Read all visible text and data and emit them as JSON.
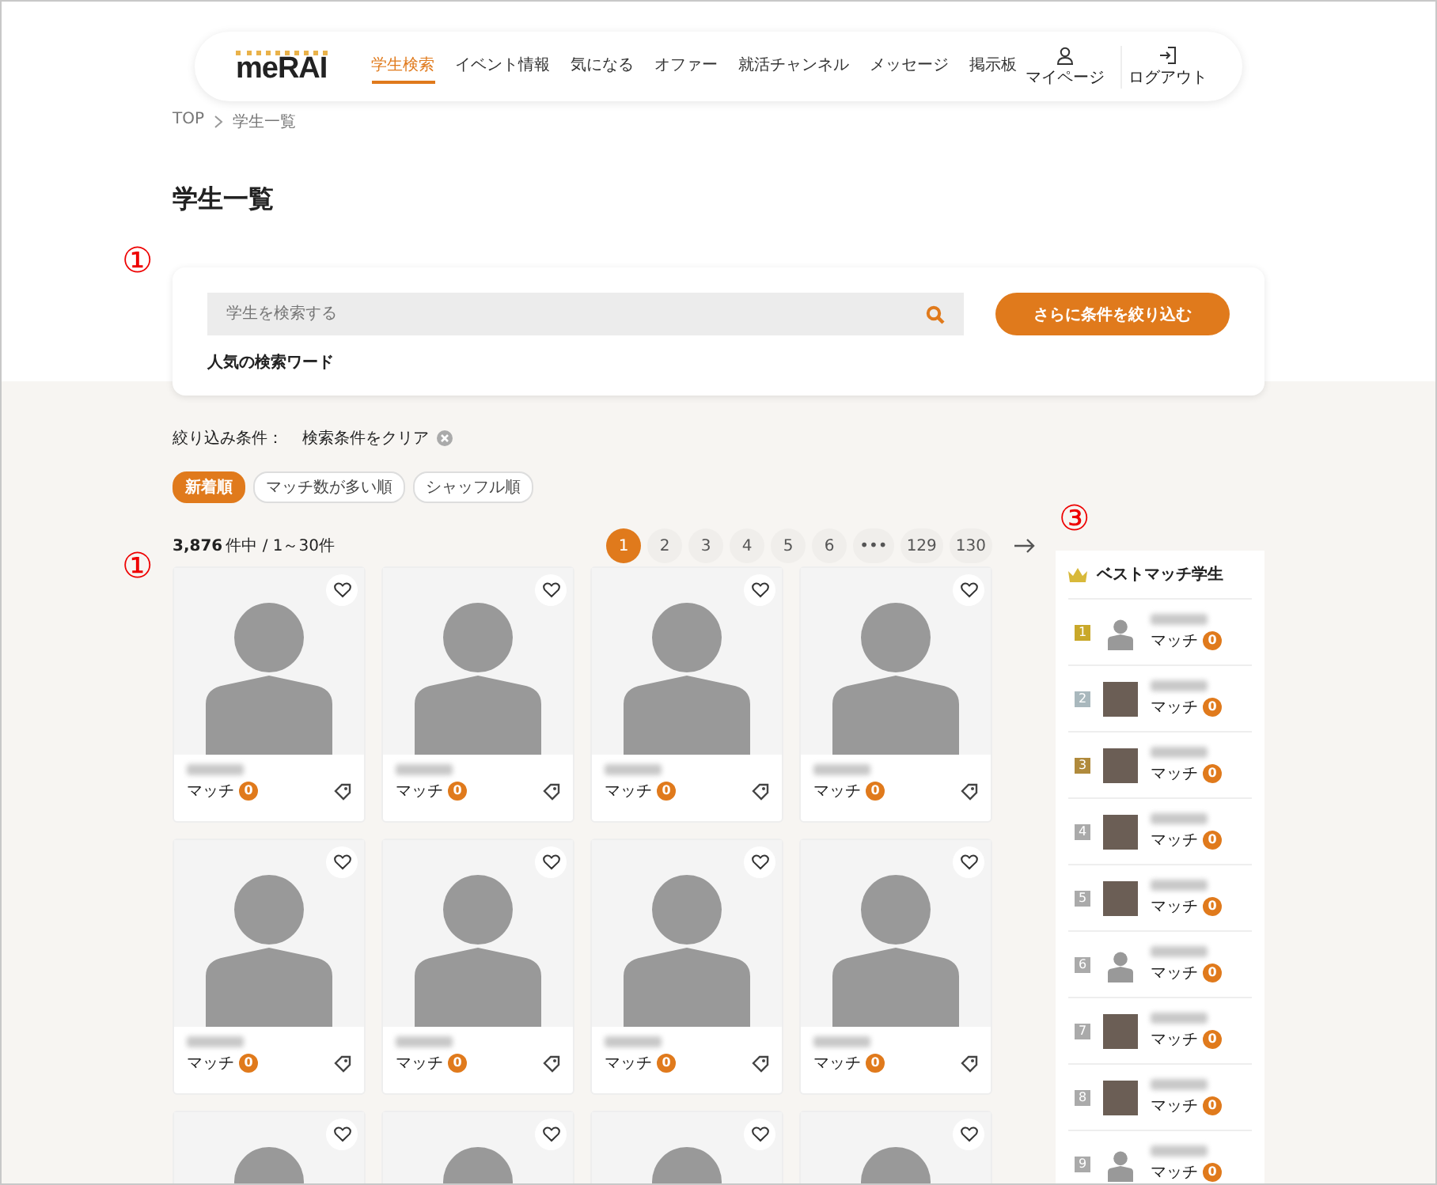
{
  "header": {
    "logo": "meRAI",
    "nav": [
      {
        "label": "学生検索",
        "selected": true
      },
      {
        "label": "イベント情報",
        "selected": false
      },
      {
        "label": "気になる",
        "selected": false
      },
      {
        "label": "オファー",
        "selected": false
      },
      {
        "label": "就活チャンネル",
        "selected": false
      },
      {
        "label": "メッセージ",
        "selected": false
      },
      {
        "label": "掲示板",
        "selected": false
      }
    ],
    "actions": [
      {
        "kind": "user",
        "label": "マイページ"
      },
      {
        "kind": "logout",
        "label": "ログアウト"
      }
    ]
  },
  "breadcrumb": [
    "TOP",
    "学生一覧"
  ],
  "page_title": "学生一覧",
  "search": {
    "annotation": "①",
    "placeholder": "学生を検索する",
    "button": "さらに条件を絞り込む",
    "popular_label": "人気の検索ワード"
  },
  "filter": {
    "label": "絞り込み条件：",
    "clear": "検索条件をクリア"
  },
  "sort": [
    {
      "label": "新着順",
      "selected": true
    },
    {
      "label": "マッチ数が多い順",
      "selected": false
    },
    {
      "label": "シャッフル順",
      "selected": false
    }
  ],
  "results": {
    "total": "3,876",
    "range": "件中 / 1～30件",
    "annotation": "①"
  },
  "pagination": [
    {
      "label": "1",
      "selected": true
    },
    {
      "label": "2",
      "selected": false
    },
    {
      "label": "3",
      "selected": false
    },
    {
      "label": "4",
      "selected": false
    },
    {
      "label": "5",
      "selected": false
    },
    {
      "label": "6",
      "selected": false
    },
    {
      "label": "•••",
      "selected": false
    },
    {
      "label": "129",
      "selected": false
    },
    {
      "label": "130",
      "selected": false
    }
  ],
  "cards": [
    {
      "favorite": false,
      "match_label": "マッチ",
      "match_count": "0"
    },
    {
      "favorite": false,
      "match_label": "マッチ",
      "match_count": "0"
    },
    {
      "favorite": false,
      "match_label": "マッチ",
      "match_count": "0"
    },
    {
      "favorite": false,
      "match_label": "マッチ",
      "match_count": "0"
    },
    {
      "favorite": false,
      "match_label": "マッチ",
      "match_count": "0"
    },
    {
      "favorite": false,
      "match_label": "マッチ",
      "match_count": "0"
    },
    {
      "favorite": false,
      "match_label": "マッチ",
      "match_count": "0"
    },
    {
      "favorite": false,
      "match_label": "マッチ",
      "match_count": "0"
    },
    {
      "favorite": false
    },
    {
      "favorite": false
    },
    {
      "favorite": false
    },
    {
      "favorite": false
    }
  ],
  "sidebar": {
    "annotation": "③",
    "title": "ベストマッチ学生",
    "items": [
      {
        "rank": "1",
        "color": "#c9a82a",
        "kind": "avatar",
        "match_label": "マッチ",
        "match_count": "0"
      },
      {
        "rank": "2",
        "color": "#a9b8bd",
        "kind": "photo",
        "match_label": "マッチ",
        "match_count": "0"
      },
      {
        "rank": "3",
        "color": "#b08a3c",
        "kind": "photo",
        "match_label": "マッチ",
        "match_count": "0"
      },
      {
        "rank": "4",
        "color": "#aaaaaa",
        "kind": "photo",
        "match_label": "マッチ",
        "match_count": "0"
      },
      {
        "rank": "5",
        "color": "#aaaaaa",
        "kind": "photo",
        "match_label": "マッチ",
        "match_count": "0"
      },
      {
        "rank": "6",
        "color": "#aaaaaa",
        "kind": "avatar",
        "match_label": "マッチ",
        "match_count": "0"
      },
      {
        "rank": "7",
        "color": "#aaaaaa",
        "kind": "photo",
        "match_label": "マッチ",
        "match_count": "0"
      },
      {
        "rank": "8",
        "color": "#aaaaaa",
        "kind": "photo",
        "match_label": "マッチ",
        "match_count": "0"
      },
      {
        "rank": "9",
        "color": "#aaaaaa",
        "kind": "avatar",
        "match_label": "マッチ",
        "match_count": "0"
      }
    ]
  }
}
